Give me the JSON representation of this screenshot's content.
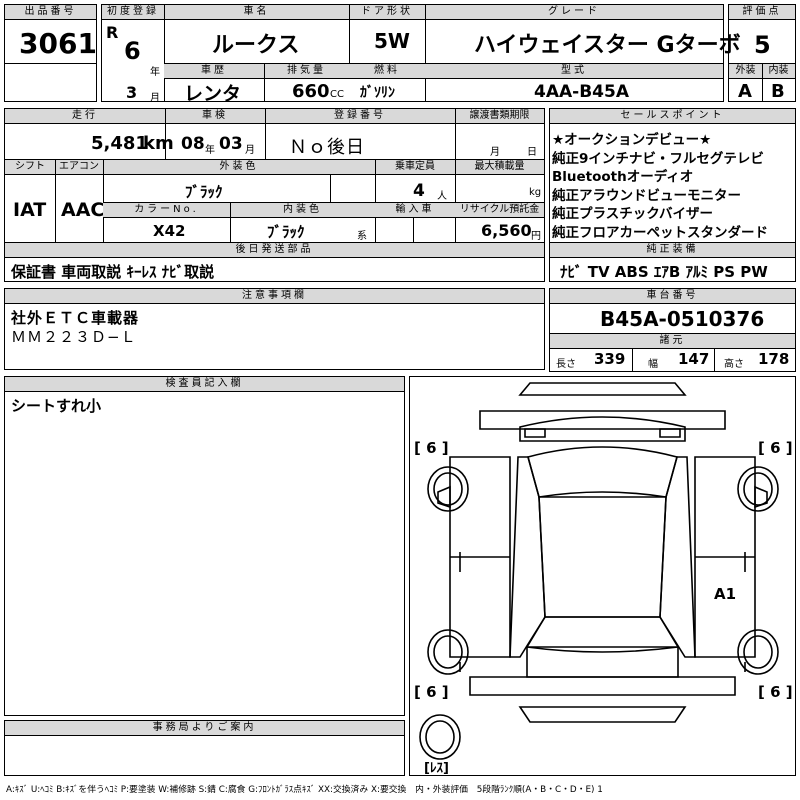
{
  "header": {
    "lot_label": "出品番号",
    "lot": "3061",
    "first_reg_label": "初度登録",
    "era": "R",
    "year": "6",
    "year_unit": "年",
    "month": "3",
    "month_unit": "月",
    "model_label": "車名",
    "model": "ルークス",
    "doors_label": "ドア形状",
    "doors": "5W",
    "grade_label": "グレード",
    "grade": "ハイウェイスター Gターボ",
    "score_label": "評価点",
    "score": "5",
    "history_label": "車歴",
    "history": "レンタ",
    "displacement_label": "排気量",
    "displacement": "660",
    "cc": "CC",
    "fuel_label": "燃料",
    "fuel": "ｶﾞｿﾘﾝ",
    "type_label": "型式",
    "type": "4AA-B45A",
    "ext_label": "外装",
    "ext": "A",
    "int_label": "内装",
    "int": "B"
  },
  "row2": {
    "mileage_label": "走行",
    "mileage": "5,481",
    "km": "km",
    "inspect_label": "車検",
    "inspect_year": "08",
    "nen": "年",
    "inspect_month": "03",
    "tsuki": "月",
    "reg_label": "登録番号",
    "reg": "Ｎｏ後日",
    "doc_label": "譲渡書類期限",
    "doc_month": "月",
    "doc_day": "日",
    "shift_label": "シフト",
    "shift": "IAT",
    "ac_label": "エアコン",
    "ac": "AAC",
    "color_label": "外装色",
    "color": "ﾌﾞﾗｯｸ",
    "seats_label": "乗車定員",
    "seats": "4",
    "seats_unit": "人",
    "load_label": "最大積載量",
    "load_unit": "kg",
    "colorno_label": "カラーNo.",
    "colorno": "X42",
    "intcolor_label": "内装色",
    "intcolor": "ﾌﾞﾗｯｸ",
    "kei": "系",
    "import_label": "輸入車",
    "recycle_label": "リサイクル預託金",
    "recycle": "6,560",
    "yen": "円",
    "later_label": "後日発送部品",
    "later": "保証書 車両取説 ｷｰﾚｽ ﾅﾋﾞ取説"
  },
  "sales": {
    "label": "セールスポイント",
    "lines": [
      "★オークションデビュー★",
      "純正9インチナビ・フルセグテレビ",
      "Bluetoothオーディオ",
      "純正アラウンドビューモニター",
      "純正プラスチックバイザー",
      "純正フロアカーペットスタンダード"
    ]
  },
  "equip": {
    "label": "純正装備",
    "items": "ﾅﾋﾞ TV ABS ｴｱB ｱﾙﾐ PS PW"
  },
  "notes": {
    "label": "注意事項欄",
    "lines": [
      "社外ＥＴＣ車載器",
      "ＭＭ２２３Ｄ−Ｌ"
    ]
  },
  "chassis": {
    "label": "車台番号",
    "value": "B45A-0510376",
    "spec_label": "諸元",
    "len_label": "長さ",
    "len": "339",
    "wid_label": "幅",
    "wid": "147",
    "hgt_label": "高さ",
    "hgt": "178"
  },
  "inspector": {
    "label": "検査員記入欄",
    "text": "シートすれ小"
  },
  "diagram": {
    "tire_fl": "[ 6 ]",
    "tire_fr": "[ 6 ]",
    "tire_rl": "[ 6 ]",
    "tire_rr": "[ 6 ]",
    "mark": "A1",
    "spare": "[ﾚｽ]"
  },
  "office": {
    "label": "事務局よりご案内"
  },
  "legend": "A:ｷｽﾞ U:ﾍｺﾐ B:ｷｽﾞを伴うﾍｺﾐ P:要塗装 W:補修跡 S:錆 C:腐食 G:ﾌﾛﾝﾄｶﾞﾗｽ点ｷｽﾞ XX:交換済み X:要交換　内・外装評価　5段階ﾗﾝｸ順(A・B・C・D・E) 1"
}
